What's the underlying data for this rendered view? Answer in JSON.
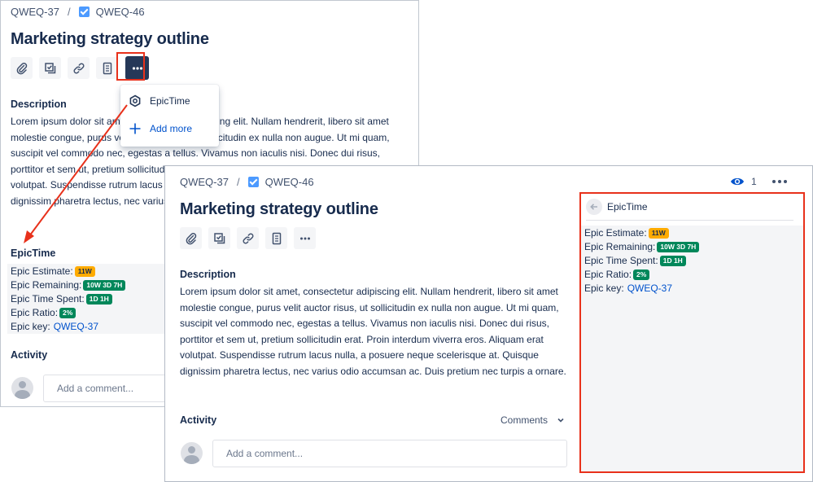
{
  "breadcrumb": {
    "parent": "QWEQ-37",
    "separator": "/",
    "current": "QWEQ-46"
  },
  "issue": {
    "title": "Marketing strategy outline"
  },
  "description": {
    "heading": "Description",
    "text": "Lorem ipsum dolor sit amet, consectetur adipiscing elit. Nullam hendrerit, libero sit amet molestie congue, purus velit auctor risus, ut sollicitudin ex nulla non augue. Ut mi quam, suscipit vel commodo nec, egestas a tellus. Vivamus non iaculis nisi. Donec dui risus, porttitor et sem ut, pretium sollicitudin erat. Proin interdum viverra eros. Aliquam erat volutpat. Suspendisse rutrum lacus nulla, a posuere neque scelerisque at. Quisque dignissim pharetra lectus, nec varius odio accumsan ac. Duis pretium nec turpis a ornare."
  },
  "menu": {
    "epictime": "EpicTime",
    "add_more": "Add more"
  },
  "epictime": {
    "heading": "EpicTime",
    "estimate_label": "Epic Estimate:",
    "estimate_value": "11W",
    "remaining_label": "Epic Remaining:",
    "remaining_value": "10W 3D 7H",
    "spent_label": "Epic Time Spent:",
    "spent_value": "1D 1H",
    "ratio_label": "Epic Ratio:",
    "ratio_value": "2%",
    "key_label": "Epic key:",
    "key_value": "QWEQ-37"
  },
  "activity": {
    "heading": "Activity",
    "comment_placeholder": "Add a comment...",
    "filter": "Comments"
  },
  "header": {
    "watch_count": "1"
  },
  "colors": {
    "annotation_red": "#e8311b",
    "lozenge_yellow": "#ffab00",
    "lozenge_green": "#00875a",
    "link_blue": "#0052cc"
  }
}
